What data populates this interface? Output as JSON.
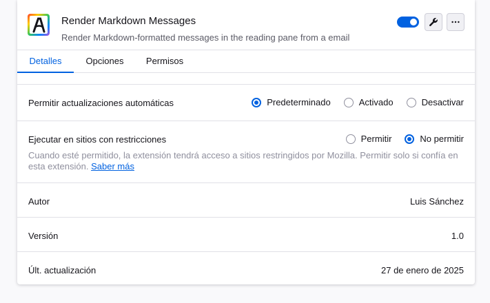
{
  "extension": {
    "name": "Render Markdown Messages",
    "description": "Render Markdown-formatted messages in the reading pane from a email",
    "enabled": true,
    "accent_color": "#0061e0"
  },
  "tabs": [
    {
      "label": "Detalles",
      "active": true
    },
    {
      "label": "Opciones",
      "active": false
    },
    {
      "label": "Permisos",
      "active": false
    }
  ],
  "auto_update": {
    "label": "Permitir actualizaciones automáticas",
    "options": [
      {
        "label": "Predeterminado",
        "checked": true
      },
      {
        "label": "Activado",
        "checked": false
      },
      {
        "label": "Desactivar",
        "checked": false
      }
    ]
  },
  "restricted_sites": {
    "label": "Ejecutar en sitios con restricciones",
    "options": [
      {
        "label": "Permitir",
        "checked": false
      },
      {
        "label": "No permitir",
        "checked": true
      }
    ],
    "note": "Cuando esté permitido, la extensión tendrá acceso a sitios restringidos por Mozilla. Permitir solo si confía en esta extensión.",
    "learn_more": "Saber más"
  },
  "details": [
    {
      "label": "Autor",
      "value": "Luis Sánchez"
    },
    {
      "label": "Versión",
      "value": "1.0"
    },
    {
      "label": "Últ. actualización",
      "value": "27 de enero de 2025"
    }
  ],
  "icons": {
    "extension": "letter-a-rainbow-icon",
    "wrench": "wrench-icon",
    "more": "more-options-icon"
  }
}
